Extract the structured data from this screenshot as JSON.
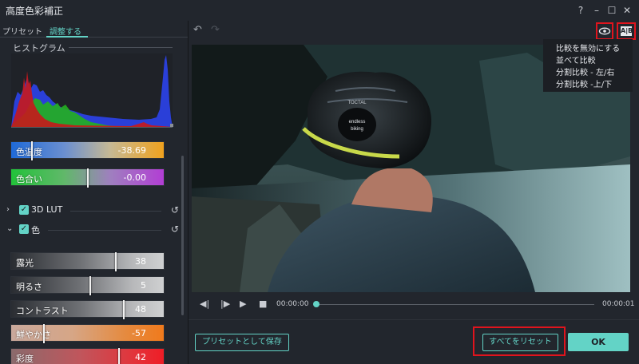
{
  "window": {
    "title": "高度色彩補正",
    "help": "?",
    "minimize": "–",
    "maximize": "☐",
    "close": "✕"
  },
  "tabs": [
    {
      "label": "プリセット",
      "active": false
    },
    {
      "label": "調整する",
      "active": true
    }
  ],
  "histogram": {
    "title": "ヒストグラム"
  },
  "sliders_top": [
    {
      "label": "色温度",
      "value": "-38.69",
      "fraction": 0.13
    },
    {
      "label": "色合い",
      "value": "-0.00",
      "fraction": 0.5
    }
  ],
  "sections": [
    {
      "label": "3D LUT",
      "expanded": false,
      "checked": true,
      "chevron": "›",
      "reset": "↺"
    },
    {
      "label": "色",
      "expanded": true,
      "checked": true,
      "chevron": "⌄",
      "reset": "↺"
    }
  ],
  "sliders_color": [
    {
      "label": "露光",
      "value": "38",
      "fraction": 0.69
    },
    {
      "label": "明るさ",
      "value": "5",
      "fraction": 0.52
    },
    {
      "label": "コントラスト",
      "value": "48",
      "fraction": 0.74
    },
    {
      "label": "鮮やかさ",
      "value": "-57",
      "fraction": 0.21
    },
    {
      "label": "彩度",
      "value": "42",
      "fraction": 0.71
    }
  ],
  "toolbar": {
    "undo": "↶",
    "redo": "↷",
    "eye_icon": "eye-icon",
    "ab_label": "A|B"
  },
  "compare_menu": [
    "比較を無効にする",
    "並べて比較",
    "分割比較 - 左/右",
    "分割比較 -上/下"
  ],
  "video": {
    "helmet_text_top": "TOCTAL",
    "helmet_text_1": "endless",
    "helmet_text_2": "biking"
  },
  "player": {
    "current_time": "00:00:00",
    "total_time": "00:00:01",
    "progress": 0.0
  },
  "buttons": {
    "save_preset": "プリセットとして保存",
    "reset_all": "すべてをリセット",
    "ok": "OK"
  },
  "colors": {
    "accent": "#63d3c6",
    "highlight_box": "#e0141d",
    "background": "#22262d"
  }
}
